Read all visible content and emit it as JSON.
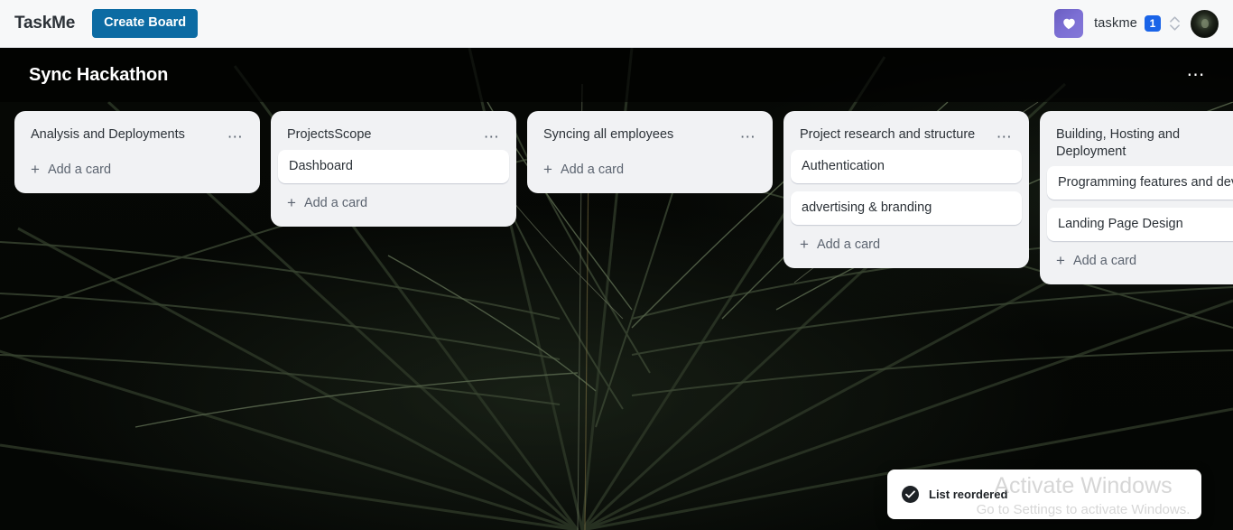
{
  "appbar": {
    "brand": "TaskMe",
    "create_board_label": "Create Board",
    "workspace_logo_icon": "heart-icon",
    "workspace_name": "taskme",
    "workspace_badge_count": "1",
    "workspace_switcher_icon": "chevron-up-down-icon",
    "avatar_icon": "user-avatar",
    "accent_button_color": "#0c6ba3",
    "badge_color": "#1a64e8",
    "workspace_logo_color": "#7168cd"
  },
  "board": {
    "title": "Sync Hackathon",
    "menu_icon": "ellipsis-icon",
    "background_type": "dark-palm-leaf-photo",
    "lists": [
      {
        "title": "Analysis and Deployments",
        "menu_icon": "ellipsis-icon",
        "cards": [],
        "add_card_label": "Add a card",
        "add_card_icon": "plus-icon"
      },
      {
        "title": "ProjectsScope",
        "menu_icon": "ellipsis-icon",
        "cards": [
          "Dashboard"
        ],
        "add_card_label": "Add a card",
        "add_card_icon": "plus-icon"
      },
      {
        "title": "Syncing all employees",
        "menu_icon": "ellipsis-icon",
        "cards": [],
        "add_card_label": "Add a card",
        "add_card_icon": "plus-icon"
      },
      {
        "title": "Project research and structure",
        "menu_icon": "ellipsis-icon",
        "cards": [
          "Authentication",
          "advertising & branding"
        ],
        "add_card_label": "Add a card",
        "add_card_icon": "plus-icon"
      },
      {
        "title": "Building, Hosting and Deployment",
        "menu_icon": "ellipsis-icon",
        "cards": [
          "Programming features and development",
          "Landing Page Design"
        ],
        "add_card_label": "Add a card",
        "add_card_icon": "plus-icon"
      }
    ]
  },
  "toast": {
    "icon": "check-circle-icon",
    "message": "List reordered"
  },
  "watermark": {
    "title": "Activate Windows",
    "subtitle": "Go to Settings to activate Windows."
  }
}
